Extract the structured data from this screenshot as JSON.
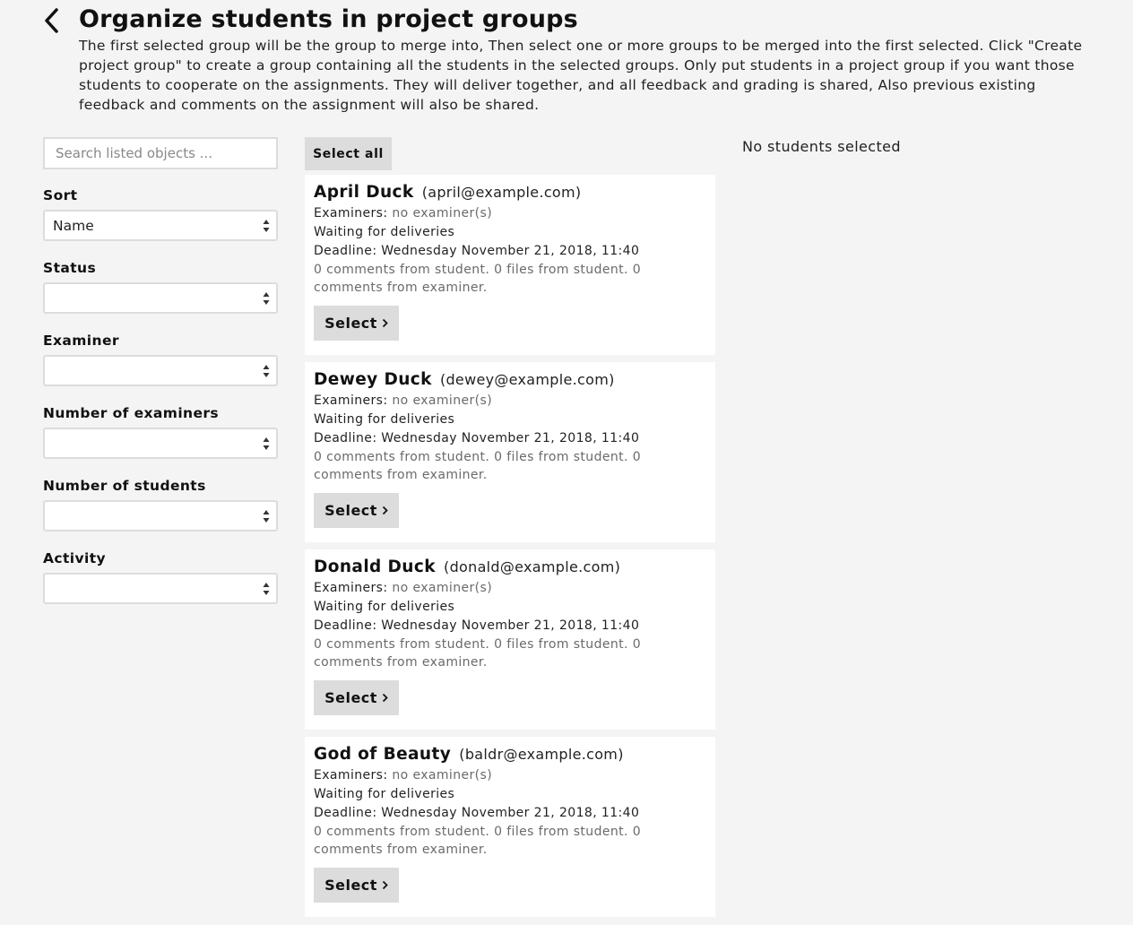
{
  "header": {
    "title": "Organize students in project groups",
    "description": "The first selected group will be the group to merge into, Then select one or more groups to be merged into the first selected. Click \"Create project group\" to create a group containing all the students in the selected groups. Only put students in a project group if you want those students to cooperate on the assignments. They will deliver together, and all feedback and grading is shared, Also previous existing feedback and comments on the assignment will also be shared.",
    "back_icon": "chevron-left-icon"
  },
  "filters": {
    "search_placeholder": "Search listed objects ...",
    "sort": {
      "label": "Sort",
      "value": "Name"
    },
    "status": {
      "label": "Status",
      "value": ""
    },
    "examiner": {
      "label": "Examiner",
      "value": ""
    },
    "num_examiners": {
      "label": "Number of examiners",
      "value": ""
    },
    "num_students": {
      "label": "Number of students",
      "value": ""
    },
    "activity": {
      "label": "Activity",
      "value": ""
    }
  },
  "list": {
    "select_all_label": "Select all",
    "groups": [
      {
        "name": "April Duck",
        "email": "(april@example.com)",
        "examiners_label": "Examiners:",
        "examiners_value": "no examiner(s)",
        "status": "Waiting for deliveries",
        "deadline": "Deadline: Wednesday November 21, 2018, 11:40",
        "stats": "0 comments from student. 0 files from student. 0 comments from examiner.",
        "select_label": "Select"
      },
      {
        "name": "Dewey Duck",
        "email": "(dewey@example.com)",
        "examiners_label": "Examiners:",
        "examiners_value": "no examiner(s)",
        "status": "Waiting for deliveries",
        "deadline": "Deadline: Wednesday November 21, 2018, 11:40",
        "stats": "0 comments from student. 0 files from student. 0 comments from examiner.",
        "select_label": "Select"
      },
      {
        "name": "Donald Duck",
        "email": "(donald@example.com)",
        "examiners_label": "Examiners:",
        "examiners_value": "no examiner(s)",
        "status": "Waiting for deliveries",
        "deadline": "Deadline: Wednesday November 21, 2018, 11:40",
        "stats": "0 comments from student. 0 files from student. 0 comments from examiner.",
        "select_label": "Select"
      },
      {
        "name": "God of Beauty",
        "email": "(baldr@example.com)",
        "examiners_label": "Examiners:",
        "examiners_value": "no examiner(s)",
        "status": "Waiting for deliveries",
        "deadline": "Deadline: Wednesday November 21, 2018, 11:40",
        "stats": "0 comments from student. 0 files from student. 0 comments from examiner.",
        "select_label": "Select"
      }
    ]
  },
  "selection": {
    "empty_text": "No students selected"
  }
}
